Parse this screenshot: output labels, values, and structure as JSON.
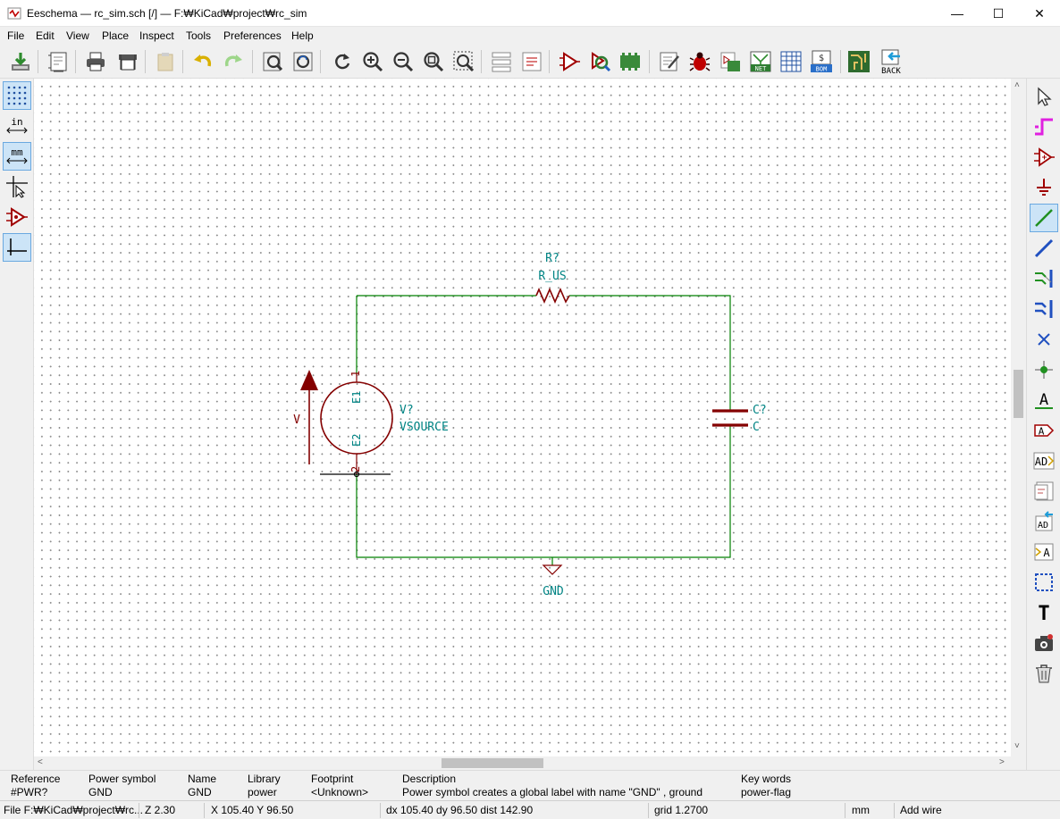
{
  "window": {
    "title": "Eeschema — rc_sim.sch [/] — F:₩KiCad₩project₩rc_sim",
    "minimize": "—",
    "maximize": "☐",
    "close": "✕"
  },
  "menu": [
    "File",
    "Edit",
    "View",
    "Place",
    "Inspect",
    "Tools",
    "Preferences",
    "Help"
  ],
  "toolbar": {
    "back_label": "BACK",
    "net_label": "NET",
    "bom_label": "BOM",
    "icons": [
      "save-icon",
      "page-settings-icon",
      "print-icon",
      "plot-icon",
      "paste-icon",
      "undo-icon",
      "redo-icon",
      "find-icon",
      "find-replace-icon",
      "refresh-icon",
      "zoom-in-icon",
      "zoom-out-icon",
      "zoom-fit-icon",
      "zoom-selection-icon",
      "hierarchy-navigator-icon",
      "leave-sheet-icon",
      "symbol-editor-icon",
      "symbol-browser-icon",
      "footprint-assign-icon",
      "annotate-icon",
      "erc-icon",
      "simulator-icon",
      "netlist-icon",
      "field-table-icon",
      "bom-icon",
      "pcbnew-icon",
      "back-annotate-icon"
    ]
  },
  "left_toolbar": {
    "grid_label": "",
    "inch_label": "in",
    "mm_label": "mm",
    "icons": [
      "grid-toggle-icon",
      "inch-units-icon",
      "mm-units-icon",
      "cursor-crosshair-icon",
      "hidden-pins-icon",
      "wire-angle-icon"
    ]
  },
  "right_toolbar": {
    "text_label_a": "A",
    "text_tool_label": "T",
    "icons": [
      "select-arrow-icon",
      "highlight-net-icon",
      "place-symbol-icon",
      "place-power-icon",
      "add-wire-icon",
      "add-bus-icon",
      "wire-entry-icon",
      "bus-entry-icon",
      "no-connect-icon",
      "junction-icon",
      "net-label-icon",
      "global-label-icon",
      "hierarchical-label-icon",
      "hierarchical-sheet-icon",
      "import-sheet-pin-icon",
      "sheet-pin-icon",
      "graphic-lines-icon",
      "text-icon",
      "add-image-icon",
      "delete-icon"
    ]
  },
  "schematic": {
    "resistor": {
      "ref": "R?",
      "value": "R_US"
    },
    "voltage_source": {
      "ref": "V?",
      "value": "VSOURCE",
      "polarity_label": "V",
      "pin1": "1",
      "pin2": "2",
      "pin1_name": "E1",
      "pin2_name": "E2"
    },
    "capacitor": {
      "ref": "C?",
      "value": "C"
    },
    "ground": {
      "label": "GND"
    },
    "colors": {
      "wire": "#008000",
      "component_body": "#840000",
      "text": "#008484",
      "ref": "#008484",
      "grid_dot": "#8a8a8a"
    }
  },
  "info_panel": [
    {
      "header": "Reference",
      "value": "#PWR?"
    },
    {
      "header": "Power symbol",
      "value": "GND"
    },
    {
      "header": "Name",
      "value": "GND"
    },
    {
      "header": "Library",
      "value": "power"
    },
    {
      "header": "Footprint",
      "value": "<Unknown>"
    },
    {
      "header": "Description",
      "value": "Power symbol creates a global label with name \"GND\" , ground"
    },
    {
      "header": "Key words",
      "value": "power-flag"
    }
  ],
  "status_bar": {
    "file": "File F:₩KiCad₩project₩rc...",
    "zoom": "Z 2.30",
    "xy": "X 105.40  Y 96.50",
    "delta": "dx 105.40  dy 96.50  dist 142.90",
    "grid": "grid 1.2700",
    "units": "mm",
    "mode": "Add wire"
  }
}
